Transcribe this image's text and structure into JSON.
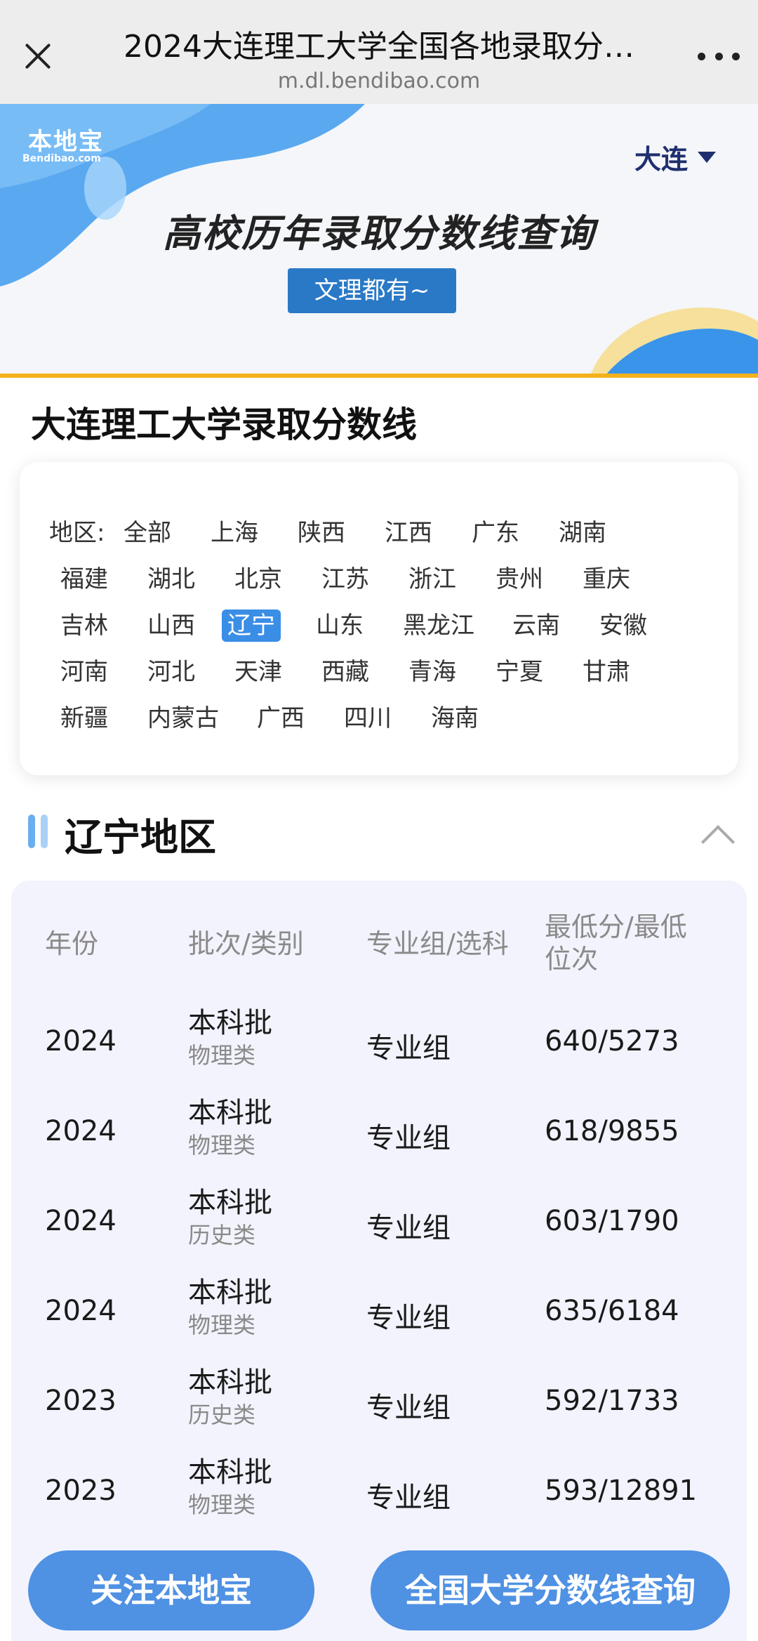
{
  "browser": {
    "title": "2024大连理工大学全国各地录取分…",
    "url": "m.dl.bendibao.com"
  },
  "banner": {
    "logo_main": "本地宝",
    "logo_sub": "Bendibao.com",
    "city": "大连",
    "title": "高校历年录取分数线查询",
    "tag": "文理都有~"
  },
  "school_heading": "大连理工大学录取分数线",
  "regions": {
    "label": "地区:",
    "selected": "辽宁",
    "rows": [
      [
        "全部",
        "上海",
        "陕西",
        "江西",
        "广东",
        "湖南"
      ],
      [
        "福建",
        "湖北",
        "北京",
        "江苏",
        "浙江",
        "贵州",
        "重庆"
      ],
      [
        "吉林",
        "山西",
        "辽宁",
        "山东",
        "黑龙江",
        "云南",
        "安徽"
      ],
      [
        "河南",
        "河北",
        "天津",
        "西藏",
        "青海",
        "宁夏",
        "甘肃"
      ],
      [
        "新疆",
        "内蒙古",
        "广西",
        "四川",
        "海南"
      ]
    ]
  },
  "area": {
    "title": "辽宁地区"
  },
  "table": {
    "headers": [
      "年份",
      "批次/类别",
      "专业组/选科",
      "最低分/最低",
      "位次"
    ],
    "rows": [
      {
        "year": "2024",
        "batch": "本科批",
        "type": "物理类",
        "group": "专业组",
        "score": "640/5273"
      },
      {
        "year": "2024",
        "batch": "本科批",
        "type": "物理类",
        "group": "专业组",
        "score": "618/9855"
      },
      {
        "year": "2024",
        "batch": "本科批",
        "type": "历史类",
        "group": "专业组",
        "score": "603/1790"
      },
      {
        "year": "2024",
        "batch": "本科批",
        "type": "物理类",
        "group": "专业组",
        "score": "635/6184"
      },
      {
        "year": "2023",
        "batch": "本科批",
        "type": "历史类",
        "group": "专业组",
        "score": "592/1733"
      },
      {
        "year": "2023",
        "batch": "本科批",
        "type": "物理类",
        "group": "专业组",
        "score": "593/12891"
      }
    ]
  },
  "actions": {
    "follow": "关注本地宝",
    "search": "全国大学分数线查询"
  },
  "colors": {
    "accent": "#3a8ee6",
    "banner_button": "#2a79c6",
    "gold_line": "#f3b21c",
    "table_bg": "#f2f3fc"
  }
}
